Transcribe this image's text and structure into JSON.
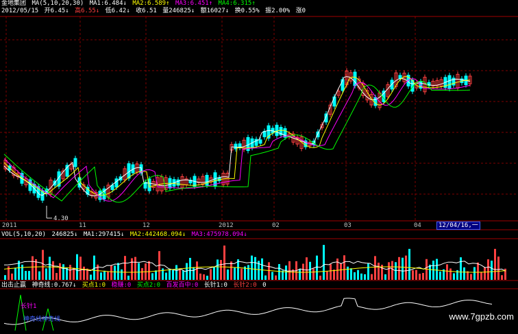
{
  "header": {
    "name": "金地集团",
    "ma_label": "MA(5,10,20,30)",
    "ma1": "MA1:6.484↓",
    "ma2": "MA2:6.589↑",
    "ma3": "MA3:6.451↑",
    "ma4": "MA4:6.315↑"
  },
  "quote": {
    "date": "2012/05/15",
    "open": "开6.45↓",
    "high": "高6.55↓",
    "low": "低6.42↓",
    "close": "收6.51",
    "volume": "量246825↓",
    "amount": "额16027↓",
    "turnover": "换0.55%",
    "amplitude": "振2.00%",
    "change": "涨0"
  },
  "price_chart": {
    "low_label": "4.30",
    "cursor_date": "12/04/16,一"
  },
  "time_axis": [
    "2011",
    "11",
    "12",
    "2012",
    "02",
    "03",
    "04"
  ],
  "vol_header": {
    "label": "VOL(5,10,20)",
    "value": "246825↓",
    "ma1": "MA1:297415↓",
    "ma2": "MA2:442468.094↓",
    "ma3": "MA3:475978.094↓"
  },
  "indicator_header": {
    "name": "出击止赢",
    "line": "神奇线:0.767↓",
    "buy": "买点1:0",
    "stable": "稳赚:0",
    "buy2": "买点2:0",
    "hit": "百发百中:0",
    "needle": "长针1:0",
    "needle2": "长针2:0",
    "extra": "0"
  },
  "indicator_overlay": {
    "label1": "长针1",
    "label2": "神奇线神奇线"
  },
  "watermark": "www.7gpzb.com",
  "colors": {
    "up": "#ff4040",
    "down": "#00ffff",
    "ma5": "#ffffff",
    "ma10": "#ffff00",
    "ma20": "#ff00ff",
    "ma30": "#00ff00",
    "grid": "#800000"
  }
}
